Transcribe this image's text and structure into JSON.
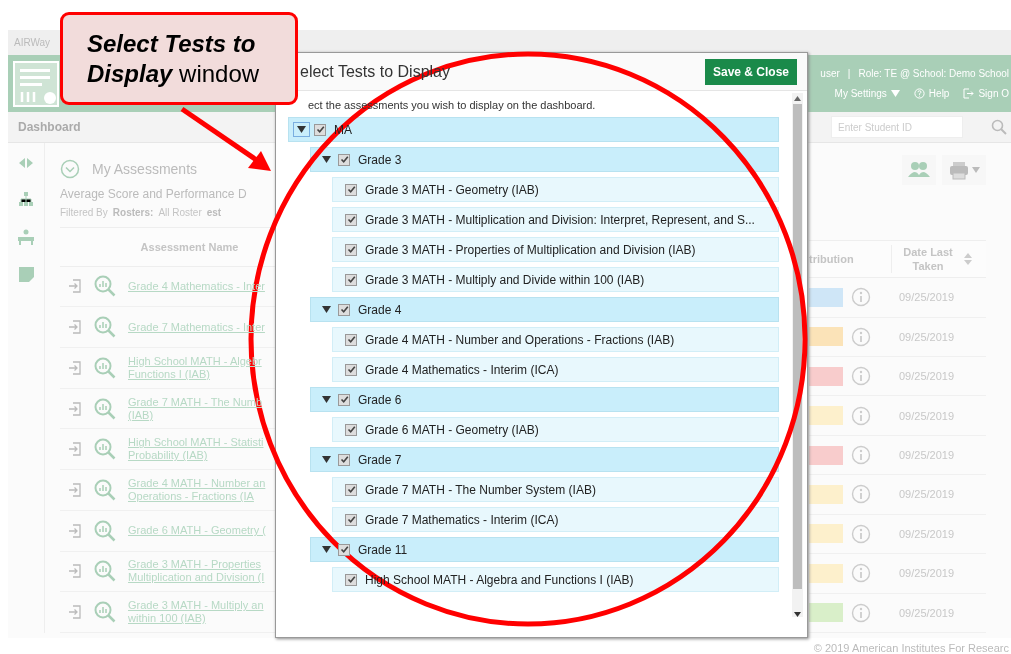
{
  "app": {
    "brand": "AIRWay",
    "user_info": "user",
    "separator": "|",
    "role_info": "Role: TE @ School: Demo School",
    "nav": [
      {
        "kind": "settings",
        "label": "My Settings"
      },
      {
        "kind": "help",
        "label": "Help"
      },
      {
        "kind": "signout",
        "label": "Sign O"
      }
    ],
    "page_title": "Dashboard",
    "student_search": {
      "placeholder": "Enter Student ID"
    },
    "section_title": "My Assessments",
    "subtitle": "Average Score and Performance D",
    "filter": {
      "label": "Filtered By",
      "rosters_label": "Rosters:",
      "rosters_value": "All Roster",
      "test_label": "est"
    },
    "table": {
      "columns": [
        "Assessment Name",
        "tribution",
        "Date Last Taken"
      ],
      "rows": [
        {
          "name_lines": [
            "Grade 4 Mathematics - Inter"
          ],
          "color": "#cfe6f7",
          "date": "09/25/2019"
        },
        {
          "name_lines": [
            "Grade 7 Mathematics - Inter"
          ],
          "color": "#fbe3b8",
          "date": "09/25/2019"
        },
        {
          "name_lines": [
            "High School MATH - Algebr",
            "Functions I (IAB)"
          ],
          "color": "#f8cccc",
          "date": "09/25/2019"
        },
        {
          "name_lines": [
            "Grade 7 MATH - The Numb",
            "(IAB)"
          ],
          "color": "#fdf0cc",
          "date": "09/25/2019"
        },
        {
          "name_lines": [
            "High School MATH - Statisti",
            "Probability (IAB)"
          ],
          "color": "#f8cccc",
          "date": "09/25/2019"
        },
        {
          "name_lines": [
            "Grade 4 MATH - Number an",
            "Operations - Fractions (IA"
          ],
          "color": "#fdf0cc",
          "date": "09/25/2019"
        },
        {
          "name_lines": [
            "Grade 6 MATH - Geometry ("
          ],
          "color": "#fdf0cc",
          "date": "09/25/2019"
        },
        {
          "name_lines": [
            "Grade 3 MATH - Properties",
            "Multiplication and Division (I"
          ],
          "color": "#fdf0cc",
          "date": "09/25/2019"
        },
        {
          "name_lines": [
            "Grade 3 MATH - Multiply an",
            "within 100 (IAB)"
          ],
          "color": "#d9efc9",
          "date": "09/25/2019"
        }
      ]
    },
    "footer": "© 2019 American Institutes For Researc"
  },
  "dialog": {
    "title": "elect Tests to Display",
    "action": "Save & Close",
    "instructions": "ect the assessments you wish to display on the dashboard.",
    "tree": [
      {
        "label": "MA",
        "checked": true,
        "expanded": true,
        "children": [
          {
            "label": "Grade 3",
            "checked": true,
            "expanded": true,
            "children": [
              {
                "label": "Grade 3 MATH - Geometry (IAB)",
                "checked": true
              },
              {
                "label": "Grade 3 MATH - Multiplication and Division: Interpret, Represent, and S...",
                "checked": true
              },
              {
                "label": "Grade 3 MATH - Properties of Multiplication and Division (IAB)",
                "checked": true
              },
              {
                "label": "Grade 3 MATH - Multiply and Divide within 100 (IAB)",
                "checked": true
              }
            ]
          },
          {
            "label": "Grade 4",
            "checked": true,
            "expanded": true,
            "children": [
              {
                "label": "Grade 4 MATH - Number and Operations - Fractions (IAB)",
                "checked": true
              },
              {
                "label": "Grade 4 Mathematics - Interim (ICA)",
                "checked": true
              }
            ]
          },
          {
            "label": "Grade 6",
            "checked": true,
            "expanded": true,
            "children": [
              {
                "label": "Grade 6 MATH - Geometry (IAB)",
                "checked": true
              }
            ]
          },
          {
            "label": "Grade 7",
            "checked": true,
            "expanded": true,
            "children": [
              {
                "label": "Grade 7 MATH - The Number System (IAB)",
                "checked": true
              },
              {
                "label": "Grade 7 Mathematics - Interim (ICA)",
                "checked": true
              }
            ]
          },
          {
            "label": "Grade 11",
            "checked": true,
            "expanded": true,
            "children": [
              {
                "label": "High School MATH - Algebra and Functions I (IAB)",
                "checked": true
              }
            ]
          }
        ]
      }
    ]
  },
  "callout": {
    "text": "**Select Tests to Display** window"
  }
}
